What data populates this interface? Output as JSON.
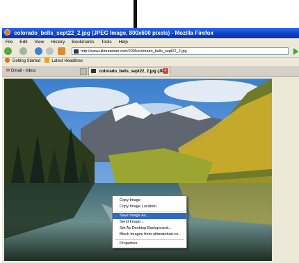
{
  "window": {
    "title": "colorado_bells_sept22_2.jpg (JPEG Image, 800x600 pixels) - Mozilla Firefox"
  },
  "menubar": {
    "items": [
      "File",
      "Edit",
      "View",
      "History",
      "Bookmarks",
      "Tools",
      "Help"
    ]
  },
  "navbar": {
    "url": "http://www.ultimatebari.com/2005/colorado_bells_sept22_2.jpg"
  },
  "bookmarks": {
    "items": [
      "Getting Started",
      "Latest Headlines"
    ]
  },
  "tabs": [
    {
      "label": "Gmail - Inbox"
    },
    {
      "label": "colorado_bells_sept22_2.jpg (JP..."
    }
  ],
  "context_menu": {
    "items": [
      "Copy Image",
      "Copy Image Location",
      "Save Image As...",
      "Send Image...",
      "Set As Desktop Background...",
      "Block Images from ultimatebari.co...",
      "Properties"
    ],
    "highlighted": "Save Image As..."
  },
  "colors": {
    "titlebar": "#0b3fc6",
    "highlight": "#316ac5",
    "arrow": "#111111"
  }
}
